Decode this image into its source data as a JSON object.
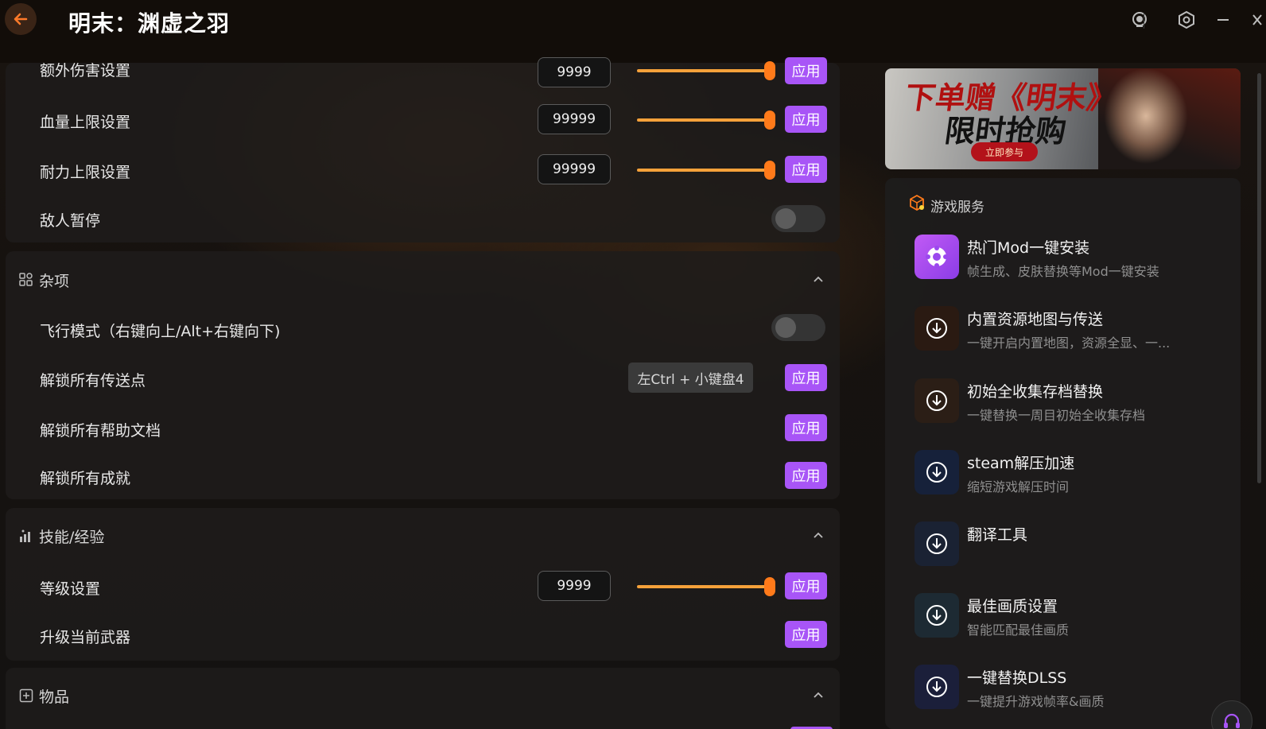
{
  "app": {
    "title": "明末：渊虚之羽"
  },
  "colors": {
    "accent": "#a855f7",
    "slider": "#ff7a1a",
    "back": "#ff7a2a"
  },
  "top_rows": [
    {
      "label": "额外伤害设置",
      "value": "9999",
      "slider_fraction": 1.0,
      "apply": "应用"
    },
    {
      "label": "血量上限设置",
      "value": "99999",
      "slider_fraction": 1.0,
      "apply": "应用"
    },
    {
      "label": "耐力上限设置",
      "value": "99999",
      "slider_fraction": 1.0,
      "apply": "应用"
    },
    {
      "label": "敌人暂停",
      "toggle": false
    }
  ],
  "sections": {
    "misc": {
      "title": "杂项",
      "icon": "grid-icon",
      "rows": [
        {
          "label": "飞行模式（右键向上/Alt+右键向下)",
          "toggle": false
        },
        {
          "label": "解锁所有传送点",
          "hotkey": "左Ctrl + 小键盘4",
          "apply": "应用"
        },
        {
          "label": "解锁所有帮助文档",
          "apply": "应用"
        },
        {
          "label": "解锁所有成就",
          "apply": "应用"
        }
      ]
    },
    "skills": {
      "title": "技能/经验",
      "icon": "bar-chart-icon",
      "rows": [
        {
          "label": "等级设置",
          "value": "9999",
          "slider_fraction": 1.0,
          "apply": "应用"
        },
        {
          "label": "升级当前武器",
          "apply": "应用"
        }
      ]
    },
    "items": {
      "title": "物品",
      "icon": "box-plus-icon"
    }
  },
  "banner": {
    "line1": "下单赠《明末》",
    "line2": "限时抢购",
    "cta": "立即参与"
  },
  "services": {
    "title": "游戏服务",
    "items": [
      {
        "name": "热门Mod一键安装",
        "desc": "帧生成、皮肤替换等Mod一键安装",
        "icon": "mod-icon"
      },
      {
        "name": "内置资源地图与传送",
        "desc": "一键开启内置地图，资源全显、一...",
        "icon": "download-icon"
      },
      {
        "name": "初始全收集存档替换",
        "desc": "一键替换一周目初始全收集存档",
        "icon": "download-icon"
      },
      {
        "name": "steam解压加速",
        "desc": "缩短游戏解压时间",
        "icon": "download-icon"
      },
      {
        "name": "翻译工具",
        "desc": "",
        "icon": "download-icon"
      },
      {
        "name": "最佳画质设置",
        "desc": "智能匹配最佳画质",
        "icon": "download-icon"
      },
      {
        "name": "一键替换DLSS",
        "desc": "一键提升游戏帧率&画质",
        "icon": "download-icon"
      }
    ]
  }
}
